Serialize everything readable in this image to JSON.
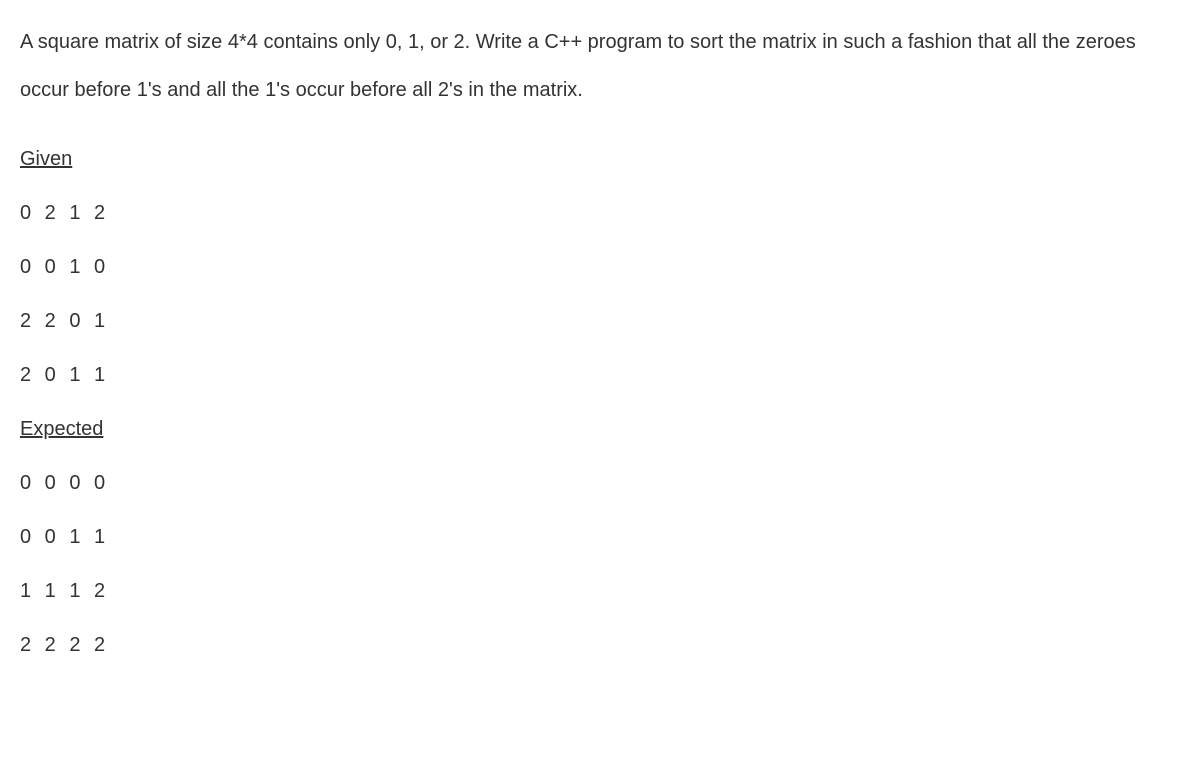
{
  "problem": {
    "statement": "A square matrix of size 4*4 contains only 0, 1, or 2. Write a C++ program to sort the matrix in such a fashion that all the zeroes occur before 1's and all the 1's occur before all 2's in the matrix."
  },
  "given": {
    "heading": "Given",
    "rows": [
      "0 2 1 2",
      "0 0 1 0",
      "2 2 0 1",
      "2 0 1 1"
    ]
  },
  "expected": {
    "heading": "Expected",
    "rows": [
      "0 0 0 0",
      "0 0 1 1",
      "1 1 1 2",
      "2 2 2 2"
    ]
  }
}
